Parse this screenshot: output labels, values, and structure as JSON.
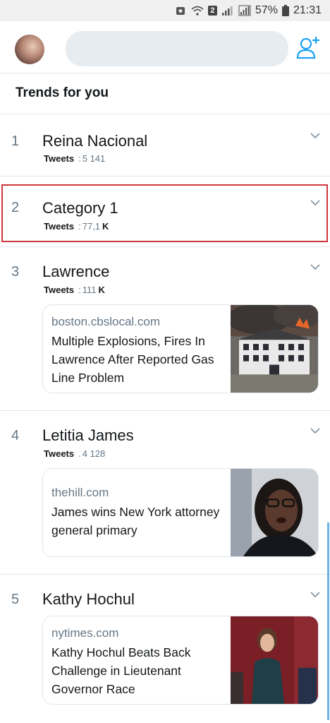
{
  "status_bar": {
    "battery": "57%",
    "time": "21:31",
    "sim_badge": "2"
  },
  "search": {
    "placeholder": ""
  },
  "header": {
    "title": "Trends for you"
  },
  "trends": [
    {
      "rank": "1",
      "name": "Reina Nacional",
      "tweets_label": "Tweets",
      "sep": ":",
      "count": "5 141",
      "unit": ""
    },
    {
      "rank": "2",
      "name": "Category 1",
      "tweets_label": "Tweets",
      "sep": ":",
      "count": "77,1",
      "unit": "K"
    },
    {
      "rank": "3",
      "name": "Lawrence",
      "tweets_label": "Tweets",
      "sep": ":",
      "count": "111",
      "unit": "K",
      "card": {
        "domain": "boston.cbslocal.com",
        "headline": "Multiple Explosions, Fires In Lawrence After Reported Gas Line Problem"
      }
    },
    {
      "rank": "4",
      "name": "Letitia James",
      "tweets_label": "Tweets",
      "sep": ".",
      "count": "4 128",
      "unit": "",
      "card": {
        "domain": "thehill.com",
        "headline": "James wins New York attorney general primary"
      }
    },
    {
      "rank": "5",
      "name": "Kathy Hochul",
      "tweets_label": "",
      "sep": "",
      "count": "",
      "unit": "",
      "card": {
        "domain": "nytimes.com",
        "headline": "Kathy Hochul Beats Back Challenge in Lieutenant Governor Race"
      }
    }
  ],
  "colors": {
    "accent": "#1da1f2",
    "highlight_border": "#d0373b",
    "secondary_text": "#657786"
  }
}
